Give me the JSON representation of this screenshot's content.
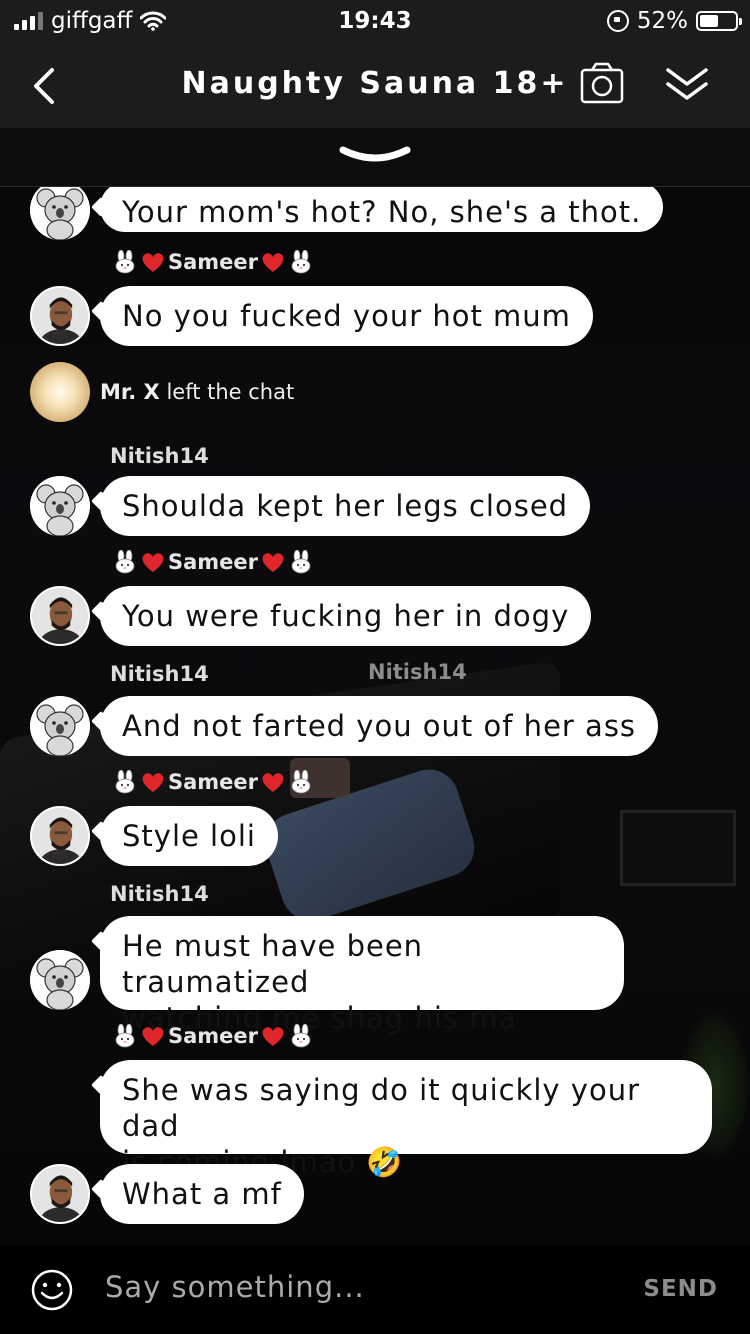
{
  "status_bar": {
    "carrier": "giffgaff",
    "time": "19:43",
    "battery_percent": "52%",
    "battery_level": 0.52
  },
  "header": {
    "title": "Naughty Sauna 18+"
  },
  "messages": [
    {
      "type": "bubble",
      "author": "",
      "avatar": "koala",
      "text": "Your mom's hot? No, she's a thot."
    },
    {
      "type": "bubble",
      "author": "Sameer",
      "avatar": "person",
      "text": "No you fucked your hot mum"
    },
    {
      "type": "system",
      "avatar": "sun",
      "user": "Mr. X",
      "text": "left the chat"
    },
    {
      "type": "bubble",
      "author": "Nitish14",
      "avatar": "koala",
      "text": "Shoulda kept her legs closed"
    },
    {
      "type": "bubble",
      "author": "Sameer",
      "avatar": "person",
      "text": "You were fucking her in dogy"
    },
    {
      "type": "bubble",
      "author": "Nitish14",
      "avatar": "koala",
      "text": "And not farted you out of her ass",
      "overlay_name": "Nitish14"
    },
    {
      "type": "bubble",
      "author": "Sameer",
      "avatar": "person",
      "text": "Style loli"
    },
    {
      "type": "bubble",
      "author": "Nitish14",
      "avatar": "koala",
      "text_lines": [
        "He must have been traumatized",
        "watching me shag his ma"
      ]
    },
    {
      "type": "bubble",
      "author": "Sameer",
      "avatar": "person",
      "text_lines": [
        "She was saying do it quickly your dad",
        "is coming lmao 🤣"
      ]
    },
    {
      "type": "bubble",
      "author": "",
      "avatar": "person",
      "text": "What a mf"
    }
  ],
  "input": {
    "placeholder": "Say something...",
    "send_label": "SEND"
  },
  "colors": {
    "bar_bg": "#1c1c1c",
    "bubble_bg": "#ffffff",
    "heart": "#e0262b"
  },
  "icons": [
    "signal-icon",
    "wifi-icon",
    "rotation-lock-icon",
    "battery-icon",
    "back-chevron-icon",
    "camera-icon",
    "double-chevron-down-icon",
    "collapse-chevron-icon",
    "bunny-icon",
    "heart-icon",
    "koala-icon",
    "smiley-icon",
    "rofl-emoji"
  ]
}
